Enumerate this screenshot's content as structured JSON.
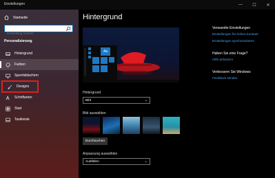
{
  "window": {
    "title": "Einstellungen",
    "controls": [
      "—",
      "☐",
      "✕"
    ]
  },
  "sidebar": {
    "home_label": "Startseite",
    "search_placeholder": "Einstellung suchen",
    "section_title": "Personalisierung",
    "items": [
      {
        "label": "Hintergrund",
        "icon": "image-icon"
      },
      {
        "label": "Farben",
        "icon": "palette-icon"
      },
      {
        "label": "Sperrbildschirm",
        "icon": "monitor-icon"
      },
      {
        "label": "Designs",
        "icon": "brush-icon"
      },
      {
        "label": "Schriftarten",
        "icon": "font-icon"
      },
      {
        "label": "Start",
        "icon": "start-icon"
      },
      {
        "label": "Taskleiste",
        "icon": "taskbar-icon"
      }
    ],
    "active_index": 1,
    "highlighted_index": 3
  },
  "main": {
    "title": "Hintergrund",
    "preview_tile_text": "Aa",
    "background_label": "Hintergrund",
    "background_value": "Bild",
    "choose_picture_label": "Bild auswählen",
    "browse_label": "Durchsuchen",
    "fit_label": "Anpassung auswählen",
    "fit_value": "Ausfüllen"
  },
  "related": {
    "heading": "Verwandte Einstellungen",
    "links": [
      "Einstellungen für hohen Kontrast",
      "Einstellungen synchronisieren"
    ]
  },
  "question": {
    "heading": "Haben Sie eine Frage?",
    "link": "Hilfe anfordern"
  },
  "improve": {
    "heading": "Verbessern Sie Windows",
    "link": "Feedback senden"
  },
  "colors": {
    "accent": "#0067b8",
    "link": "#4aa3e8",
    "highlight_border": "#e02020"
  }
}
